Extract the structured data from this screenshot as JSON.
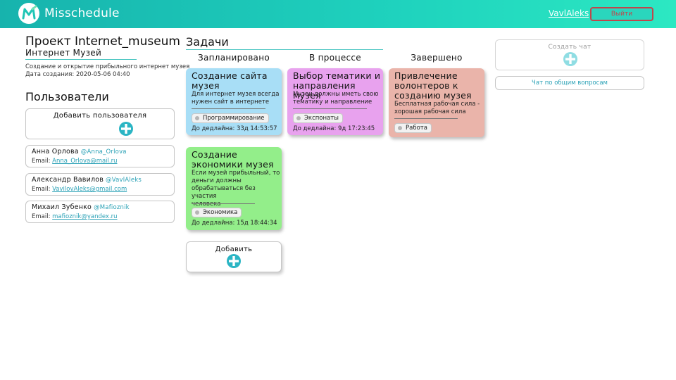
{
  "header": {
    "brand": "Misschedule",
    "logo_letter": "M",
    "user_link": "VavlAleks",
    "logout_label": "Выйти",
    "gradient_start": "#17b3ad",
    "gradient_end": "#2ce8c2"
  },
  "project": {
    "title": "Проект Internet_museum",
    "subtitle": "Интернет Музей",
    "description": "Создание и открытие прибыльного интернет музея",
    "created": "Дата создания: 2020-05-06 04:40"
  },
  "users": {
    "title": "Пользователи",
    "add_label": "Добавить пользователя",
    "email_prefix": "Email:",
    "list": [
      {
        "name": "Анна Орлова",
        "nick": "@Anna_Orlova",
        "email": "Anna_Orlova@mail.ru"
      },
      {
        "name": "Александр Вавилов",
        "nick": "@VavlAleks",
        "email": "VavilovAleks@gmail.com"
      },
      {
        "name": "Михаил Зубенко",
        "nick": "@Mafioznik",
        "email": "mafioznik@yandex.ru"
      }
    ]
  },
  "tasks": {
    "title": "Задачи",
    "columns": [
      "Запланировано",
      "В процессе",
      "Завершено"
    ],
    "add_label": "Добавить",
    "cards": [
      {
        "title_lines": [
          "Создание сайта",
          "музея"
        ],
        "desc_lines": [
          "Для интернет музея всегда",
          "нужен сайт в интернете"
        ],
        "tag": "Программирование",
        "deadline": "До дедлайна: 33д 14:53:57",
        "color": "#a8def6"
      },
      {
        "title_lines": [
          "Выбор тематики и",
          "направления музея"
        ],
        "desc_lines": [
          "Музеи должны иметь свою",
          "тематику и направление"
        ],
        "tag": "Экспонаты",
        "deadline": "До дедлайна: 9д 17:23:45",
        "color": "#e8a2ee"
      },
      {
        "title_lines": [
          "Привлечение",
          "волонтеров к",
          "созданию музея"
        ],
        "desc_lines": [
          "Бесплатная рабочая сила -",
          "хорошая рабочая сила"
        ],
        "tag": "Работа",
        "deadline": "",
        "color": "#eab4aa"
      },
      {
        "title_lines": [
          "Создание",
          "экономики музея"
        ],
        "desc_lines": [
          "Если музей прибыльный, то",
          "деньги должны",
          "обрабатываться без участия",
          "человека"
        ],
        "tag": "Экономика",
        "deadline": "До дедлайна: 15д 18:44:34",
        "color": "#93ee8a"
      }
    ]
  },
  "sidebar_right": {
    "create_chat_label": "Создать чат",
    "general_chat_label": "Чат по общим вопросам"
  },
  "colors": {
    "accent": "#2aa1b6",
    "plus_icon": "#2bb5c4",
    "logout_border": "#c0464b"
  }
}
